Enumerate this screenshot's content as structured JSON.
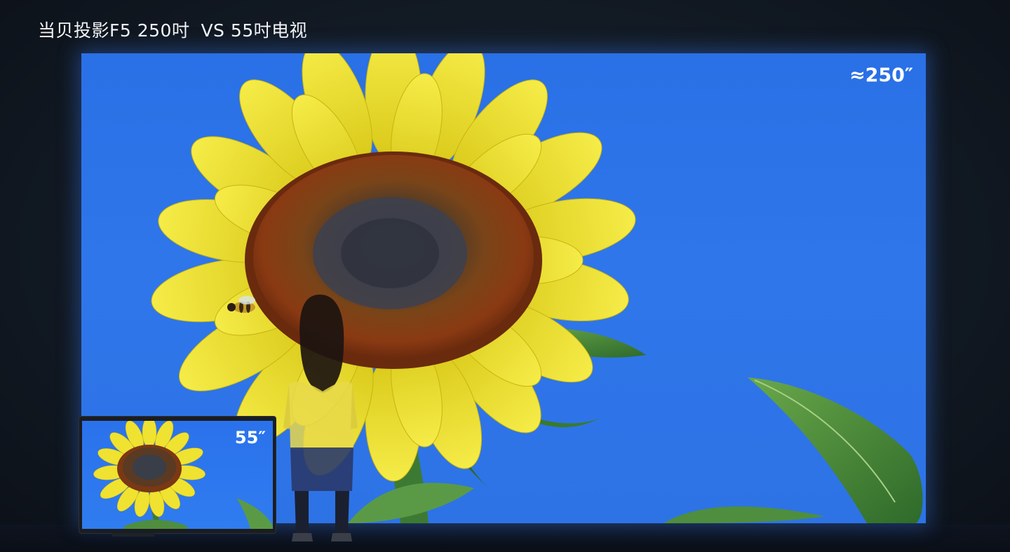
{
  "headline": {
    "brand_part": "当贝投影F5 250吋",
    "vs_part": "VS 55吋电视"
  },
  "projection": {
    "size_label": "≈250″"
  },
  "tv": {
    "size_label": "55″"
  },
  "colors": {
    "sky_blue": "#2d73e6",
    "petal_yellow": "#f2e22a",
    "flower_center": "#7a3a14",
    "leaf_green": "#4a8a3a",
    "room_dark": "#121a24"
  },
  "icons": {
    "subject": "sunflower-image",
    "insect": "bee-icon",
    "figure": "child-silhouette"
  }
}
